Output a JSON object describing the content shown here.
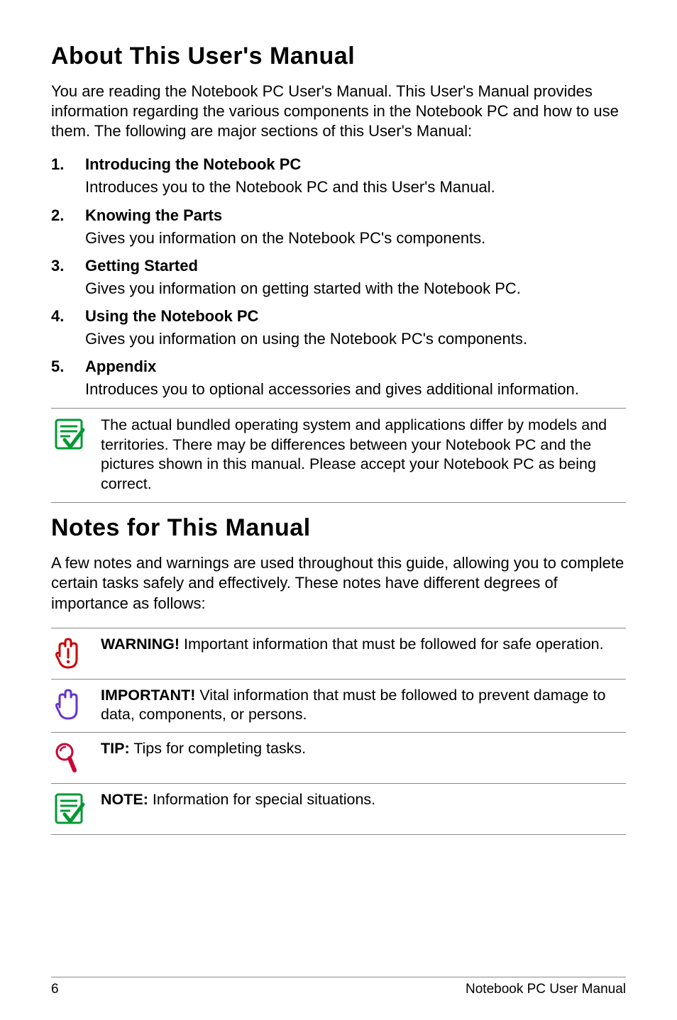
{
  "section1": {
    "title": "About This User's Manual",
    "intro": "You are reading the Notebook PC User's Manual. This User's Manual provides information regarding the various components in the Notebook PC and how to use them. The following are major sections of this User's Manual:",
    "items": [
      {
        "title": "Introducing the Notebook PC",
        "desc": "Introduces you to the Notebook PC and this User's Manual."
      },
      {
        "title": "Knowing the Parts",
        "desc": "Gives you information on the Notebook PC's components."
      },
      {
        "title": "Getting Started",
        "desc": "Gives you information on getting started with the Notebook PC."
      },
      {
        "title": "Using the Notebook PC",
        "desc": "Gives you information on using the Notebook PC's components."
      },
      {
        "title": "Appendix",
        "desc": "Introduces you to optional accessories and gives additional information."
      }
    ],
    "note": "The actual bundled operating system and applications differ by models and territories. There may be differences between your Notebook PC and the pictures shown in this manual. Please accept your Notebook PC as being correct."
  },
  "section2": {
    "title": "Notes for This Manual",
    "intro": "A few notes and warnings are used throughout this guide, allowing you to complete certain tasks safely and effectively. These notes have different degrees of importance as follows:",
    "notes": [
      {
        "label": "WARNING!",
        "text": " Important information that must be followed for safe operation."
      },
      {
        "label": "IMPORTANT!",
        "text": " Vital information that must be followed to prevent damage to data, components, or persons."
      },
      {
        "label": "TIP:",
        "text": " Tips for completing tasks."
      },
      {
        "label": "NOTE:",
        "text": "  Information for special situations."
      }
    ]
  },
  "footer": {
    "page": "6",
    "title": "Notebook PC User Manual"
  }
}
